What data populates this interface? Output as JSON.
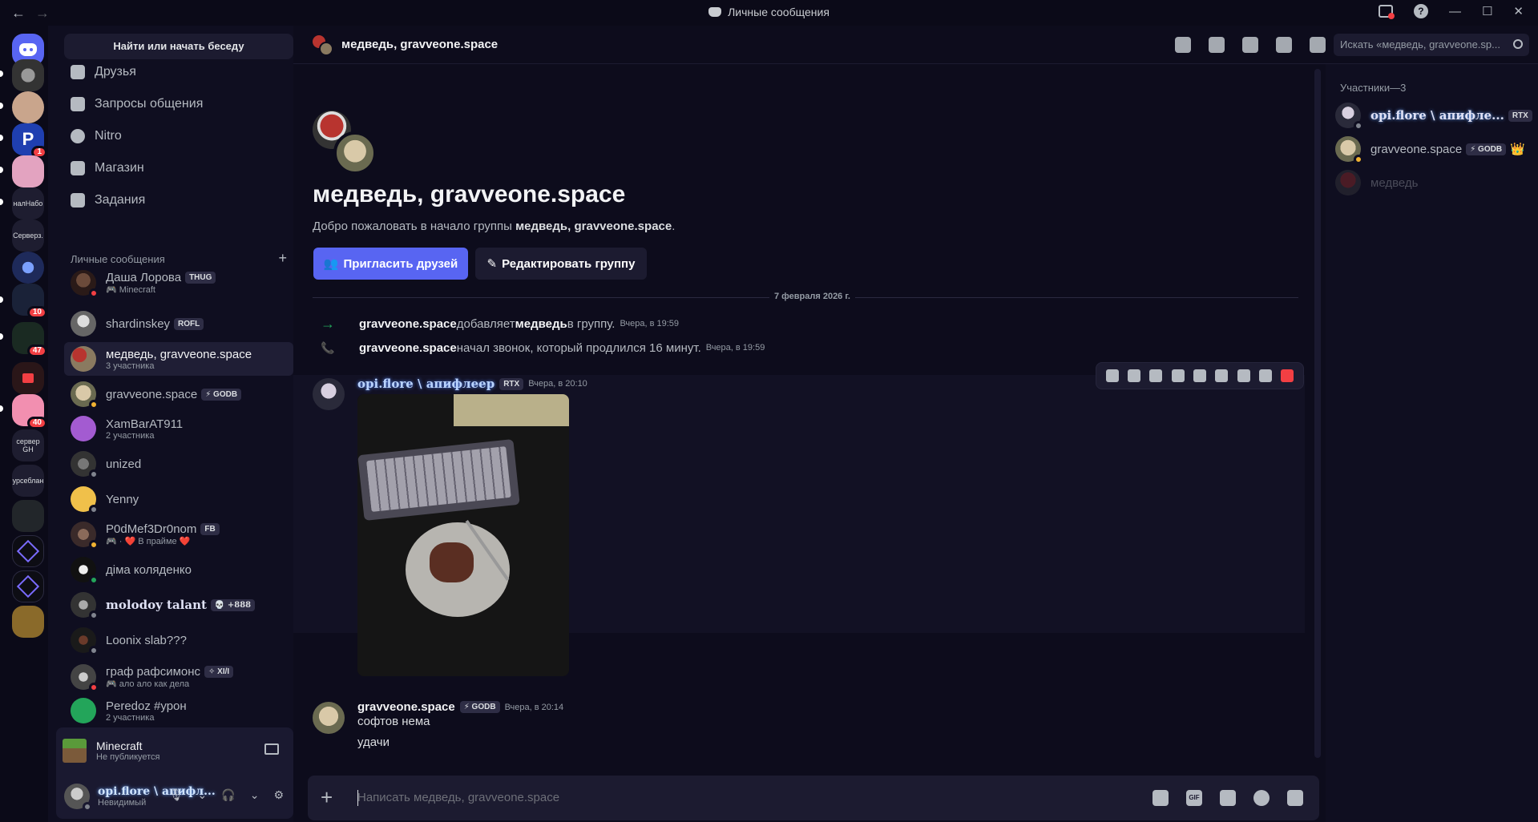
{
  "window": {
    "title": "Личные сообщения",
    "back": "←",
    "forward": "→",
    "help": "?",
    "min": "—",
    "max": "☐",
    "close": "✕"
  },
  "rail": {
    "items": [
      {
        "label": "",
        "kind": "home"
      },
      {
        "label": "",
        "kind": "server",
        "badge": ""
      },
      {
        "label": "",
        "kind": "server",
        "badge": ""
      },
      {
        "label": "P",
        "kind": "server",
        "badge": "1"
      },
      {
        "label": "",
        "kind": "server",
        "badge": ""
      },
      {
        "label": "налНабо",
        "kind": "text",
        "badge": ""
      },
      {
        "label": "Серверз.",
        "kind": "text",
        "badge": ""
      },
      {
        "label": "",
        "kind": "server",
        "badge": ""
      },
      {
        "label": "",
        "kind": "folder",
        "badge": "10"
      },
      {
        "label": "",
        "kind": "folder",
        "badge": "47"
      },
      {
        "label": "",
        "kind": "folder",
        "badge": ""
      },
      {
        "label": "",
        "kind": "server",
        "badge": "40"
      },
      {
        "label": "сервер GH",
        "kind": "text",
        "badge": ""
      },
      {
        "label": "урсеблан",
        "kind": "text",
        "badge": ""
      },
      {
        "label": "",
        "kind": "server",
        "badge": ""
      },
      {
        "label": "",
        "kind": "server",
        "badge": ""
      },
      {
        "label": "",
        "kind": "server",
        "badge": ""
      },
      {
        "label": "",
        "kind": "server",
        "badge": ""
      }
    ]
  },
  "sidebar": {
    "search_label": "Найти или начать беседу",
    "nav": [
      {
        "label": "Друзья",
        "icon": "friends-icon"
      },
      {
        "label": "Запросы общения",
        "icon": "mail-icon"
      },
      {
        "label": "Nitro",
        "icon": "nitro-icon"
      },
      {
        "label": "Магазин",
        "icon": "shop-icon"
      },
      {
        "label": "Задания",
        "icon": "quests-icon"
      }
    ],
    "section_title": "Личные сообщения",
    "section_add": "+",
    "dms": [
      {
        "name": "Даша Лорова",
        "tag": "THUG",
        "sub": "🎮 Minecraft",
        "status": "#f23f43"
      },
      {
        "name": "shardinskey",
        "tag": "ROFL",
        "sub": "",
        "status": ""
      },
      {
        "name": "медведь, gravveone.space",
        "tag": "",
        "sub": "3 участника",
        "status": ""
      },
      {
        "name": "gravveone.space",
        "tag": "⚡ GODB",
        "sub": "",
        "status": "#f0b232"
      },
      {
        "name": "ХamBarAT911",
        "tag": "",
        "sub": "2 участника",
        "status": ""
      },
      {
        "name": "unized",
        "tag": "",
        "sub": "",
        "status": "#80848e"
      },
      {
        "name": "Yenny",
        "tag": "",
        "sub": "",
        "status": "#80848e"
      },
      {
        "name": "P0dMef3Dr0nom",
        "tag": "FB",
        "sub": "🎮 · ❤️ В прайме ❤️",
        "status": "#f0b232"
      },
      {
        "name": "діма коляденко",
        "tag": "",
        "sub": "",
        "status": "#23a55a"
      },
      {
        "name": "molodoy talant",
        "tag": "💀 +888",
        "sub": "",
        "status": "#80848e"
      },
      {
        "name": "Loonix slab???",
        "tag": "",
        "sub": "",
        "status": "#80848e"
      },
      {
        "name": "граф рафсимонс",
        "tag": "✧ XI/I",
        "sub": "🎮 ало ало как дела",
        "status": "#f23f43"
      },
      {
        "name": "Peredoz #урон",
        "tag": "",
        "sub": "2 участника",
        "status": ""
      }
    ]
  },
  "activity": {
    "game": "Minecraft",
    "status": "Не публикуется"
  },
  "user": {
    "name": "opi.flore \\ апифл...",
    "status": "Невидимый"
  },
  "header": {
    "title": "медведь, gravveone.space",
    "search_placeholder": "Искать «медведь, gravveone.sp..."
  },
  "chat": {
    "group_name": "медведь, gravveone.space",
    "welcome_prefix": "Добро пожаловать в начало группы ",
    "welcome_name": "медведь, gravveone.space",
    "welcome_suffix": ".",
    "invite_label": "Пригласить друзей",
    "edit_label": "Редактировать группу",
    "date_divider": "7 февраля 2026 г.",
    "system": [
      {
        "icon": "→",
        "actor": "gravveone.space",
        "text1": " добавляет ",
        "target": "медведь",
        "text2": " в группу.",
        "ts": "Вчера, в 19:59"
      },
      {
        "icon": "📞",
        "actor": "gravveone.space",
        "text1": " начал звонок, который продлился 16 минут.",
        "target": "",
        "text2": "",
        "ts": "Вчера, в 19:59"
      }
    ],
    "messages": [
      {
        "author": "opi.flore \\ апифлеер",
        "tag": "RTX",
        "ts": "Вчера, в 20:10",
        "lines": []
      },
      {
        "author": "gravveone.space",
        "tag": "⚡ GODB",
        "ts": "Вчера, в 20:14",
        "lines": [
          "софтов нема",
          "удачи"
        ]
      }
    ],
    "composer_placeholder": "Написать медведь, gravveone.space",
    "gif_label": "GIF"
  },
  "members": {
    "header": "Участники—3",
    "list": [
      {
        "name": "opi.flore \\ апифле...",
        "tag": "RTX",
        "status": "#80848e",
        "offline": false,
        "owner": ""
      },
      {
        "name": "gravveone.space",
        "tag": "⚡ GODB",
        "status": "#f0b232",
        "offline": false,
        "owner": "👑"
      },
      {
        "name": "медведь",
        "tag": "",
        "status": "",
        "offline": true,
        "owner": ""
      }
    ]
  }
}
